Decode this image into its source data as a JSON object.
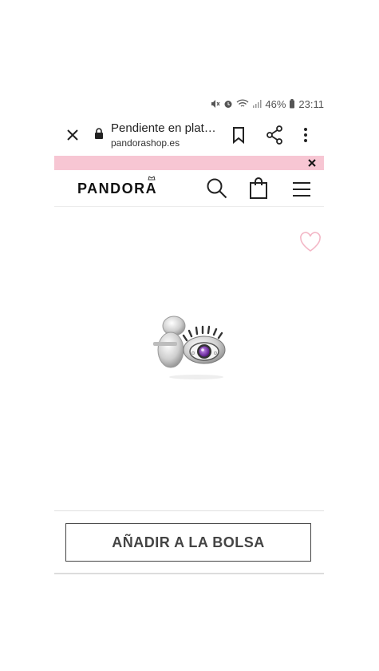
{
  "status_bar": {
    "battery": "46%",
    "time": "23:11",
    "icons": [
      "mute-icon",
      "alarm-icon",
      "wifi-icon",
      "signal-icon",
      "battery-icon"
    ]
  },
  "browser": {
    "page_title": "Pendiente en plat…",
    "host": "pandorashop.es",
    "icons": [
      "close-icon",
      "lock-icon",
      "bookmark-icon",
      "share-icon",
      "more-icon"
    ]
  },
  "promo": {
    "color": "#f7c6d3",
    "icons": [
      "close-icon"
    ]
  },
  "header": {
    "logo": "PANDORA",
    "icons": [
      "search-icon",
      "bag-icon",
      "menu-icon"
    ]
  },
  "product": {
    "icons": [
      "heart-icon"
    ],
    "image": "evil-eye-stud-earring-with-purple-stone"
  },
  "cta": {
    "label": "AÑADIR A LA BOLSA"
  },
  "colors": {
    "promo": "#f7c6d3",
    "heart": "#f3b7c6",
    "cta_border": "#444444"
  }
}
